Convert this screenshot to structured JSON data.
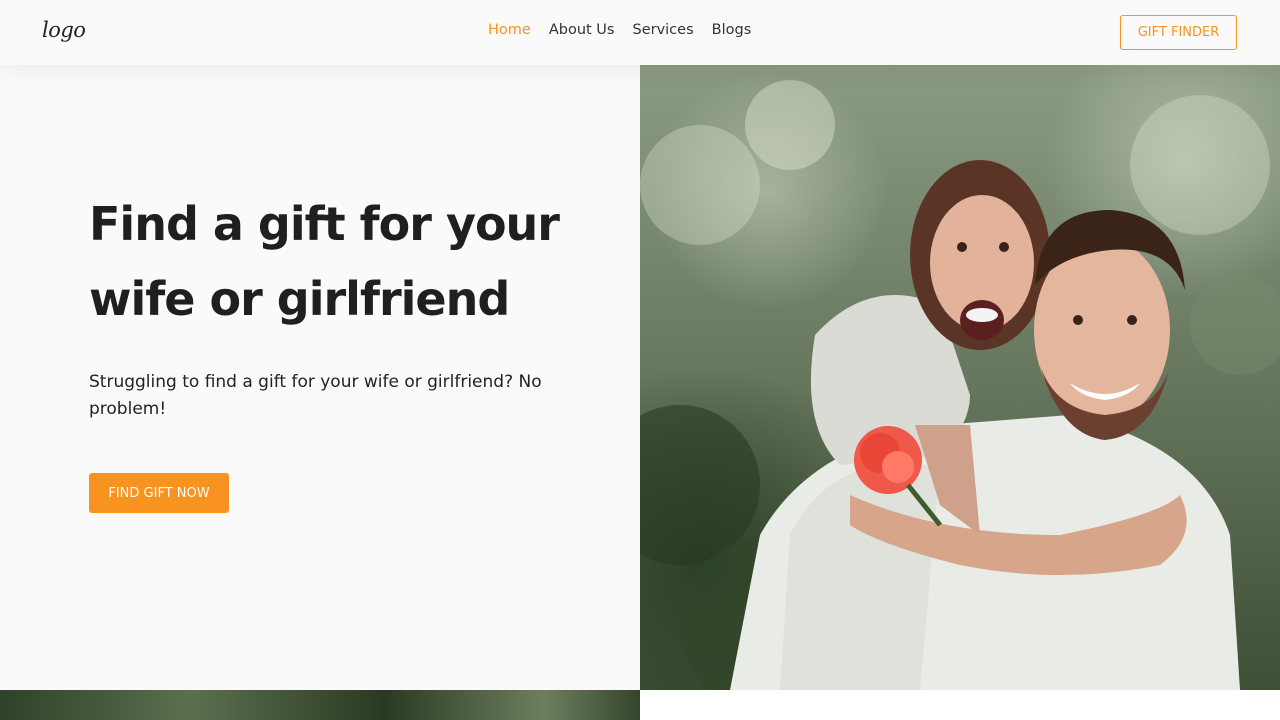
{
  "header": {
    "logo_text": "logo",
    "nav": [
      {
        "label": "Home",
        "active": true
      },
      {
        "label": "About Us",
        "active": false
      },
      {
        "label": "Services",
        "active": false
      },
      {
        "label": "Blogs",
        "active": false
      }
    ],
    "cta_label": "GIFT FINDER"
  },
  "hero": {
    "title": "Find a gift for your wife or girlfriend",
    "subtitle": "Struggling to find a gift for your wife or girlfriend? No problem!",
    "button_label": "FIND GIFT NOW",
    "image_icon": "couple-photo"
  },
  "colors": {
    "accent": "#f7931e",
    "text": "#1f1f1f",
    "background": "#fafafa"
  }
}
